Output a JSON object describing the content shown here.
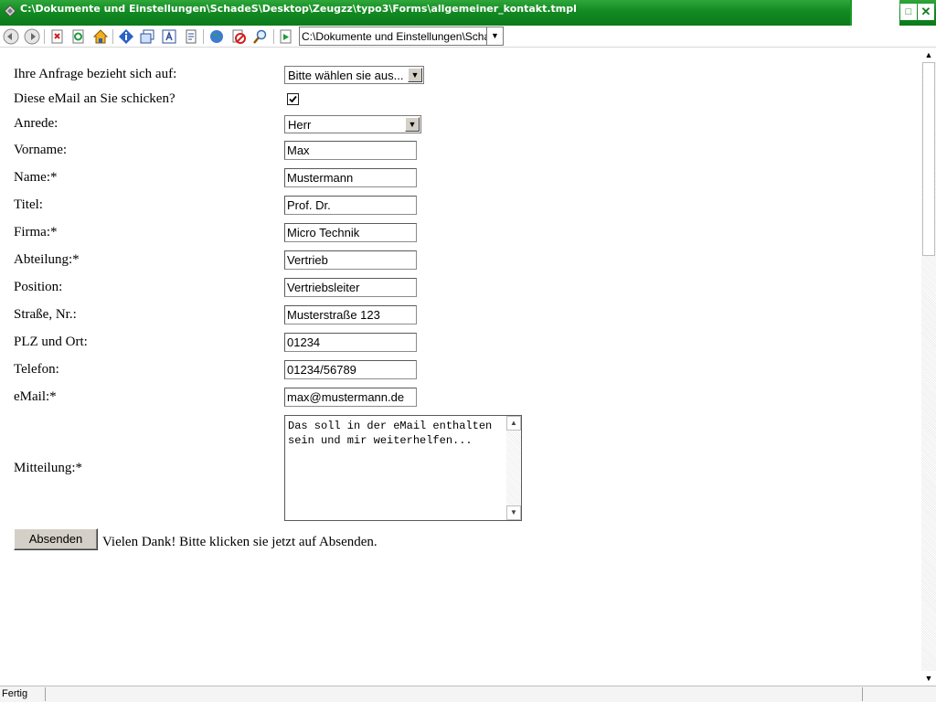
{
  "window": {
    "title": "C:\\Dokumente und Einstellungen\\SchadeS\\Desktop\\Zeugzz\\typo3\\Forms\\allgemeiner_kontakt.tmpl",
    "maximize_glyph": "□",
    "close_glyph": "✕"
  },
  "toolbar": {
    "address_value": "C:\\Dokumente und Einstellungen\\SchadeS",
    "address_dropdown_glyph": "▼",
    "icons": [
      "back-icon",
      "forward-icon",
      "stop-icon",
      "refresh-icon",
      "home-icon",
      "info-icon",
      "new-window-icon",
      "text-icon",
      "page-icon",
      "globe-icon",
      "no-entry-icon",
      "search-icon",
      "go-icon"
    ]
  },
  "form": {
    "request_label": "Ihre Anfrage bezieht sich auf:",
    "request_value": "Bitte wählen sie aus...",
    "send_copy_label": "Diese eMail an Sie schicken?",
    "send_copy_checked": true,
    "salutation_label": "Anrede:",
    "salutation_value": "Herr",
    "firstname_label": "Vorname:",
    "firstname_value": "Max",
    "name_label": "Name:*",
    "name_value": "Mustermann",
    "title_label": "Titel:",
    "title_value": "Prof. Dr.",
    "company_label": "Firma:*",
    "company_value": "Micro Technik",
    "department_label": "Abteilung:*",
    "department_value": "Vertrieb",
    "position_label": "Position:",
    "position_value": "Vertriebsleiter",
    "street_label": "Straße, Nr.:",
    "street_value": "Musterstraße 123",
    "zip_city_label": "PLZ und Ort:",
    "zip_city_value": "01234",
    "phone_label": "Telefon:",
    "phone_value": "01234/56789",
    "email_label": "eMail:*",
    "email_value": "max@mustermann.de",
    "message_label": "Mitteilung:*",
    "message_value": "Das soll in der eMail enthalten sein und mir weiterhelfen...",
    "submit_label": "Absenden",
    "thanks_text": "Vielen Dank! Bitte klicken sie jetzt auf Absenden.",
    "dropdown_glyph": "▼",
    "check_glyph": "✓"
  },
  "scrollbar": {
    "up_glyph": "▲",
    "down_glyph": "▼"
  },
  "statusbar": {
    "text": "Fertig"
  }
}
